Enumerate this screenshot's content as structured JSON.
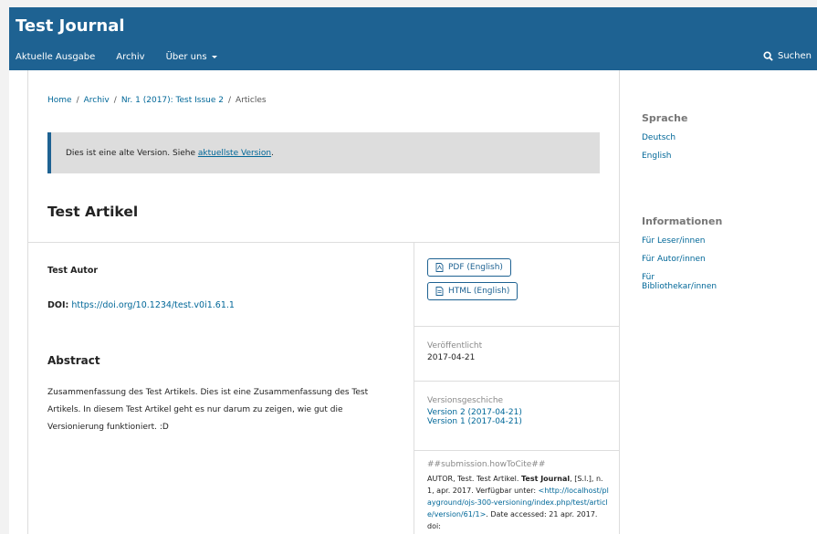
{
  "header": {
    "title": "Test Journal",
    "nav": [
      "Aktuelle Ausgabe",
      "Archiv",
      "Über uns"
    ],
    "search_label": "Suchen"
  },
  "breadcrumb": [
    "Home",
    "Archiv",
    "Nr. 1 (2017): Test Issue 2",
    "Articles"
  ],
  "notice": {
    "text": "Dies ist eine alte Version. Siehe",
    "link": "aktuellste Version",
    "suffix": "."
  },
  "article": {
    "title": "Test Artikel",
    "author": "Test Autor",
    "doi_label": "DOI:",
    "doi_url": "https://doi.org/10.1234/test.v0i1.61.1",
    "abstract_heading": "Abstract",
    "abstract_text": "Zusammenfassung des Test Artikels. Dies ist eine Zusammenfassung des Test Artikels. In diesem Test Artikel geht es nur darum zu zeigen, wie gut die Versionierung funktioniert. :D"
  },
  "galleys": [
    {
      "label": "PDF (English)",
      "icon": "pdf-file-icon"
    },
    {
      "label": "HTML (English)",
      "icon": "html-file-icon"
    }
  ],
  "published": {
    "label": "Veröffentlicht",
    "date": "2017-04-21"
  },
  "versions": {
    "label": "Versionsgeschiche",
    "items": [
      "Version 2 (2017-04-21)",
      "Version 1 (2017-04-21)"
    ]
  },
  "cite": {
    "label": "##submission.howToCite##",
    "line1_pre": "AUTOR, Test. Test Artikel.",
    "journal": "Test Journal",
    "line1_post": ", [S.l.],",
    "line2": "n. 1, apr. 2017. Verfügbar unter:",
    "link": "<http://localhost/playground/ojs-300-versioning/index.php/test/article/version/61/1>",
    "tail": ". Date accessed: 21 apr. 2017. doi:"
  },
  "sidebar": {
    "language_title": "Sprache",
    "languages": [
      "Deutsch",
      "English"
    ],
    "info_title": "Informationen",
    "info_links": [
      "Für Leser/innen",
      "Für Autor/innen",
      "Für Bibliothekar/innen"
    ]
  }
}
